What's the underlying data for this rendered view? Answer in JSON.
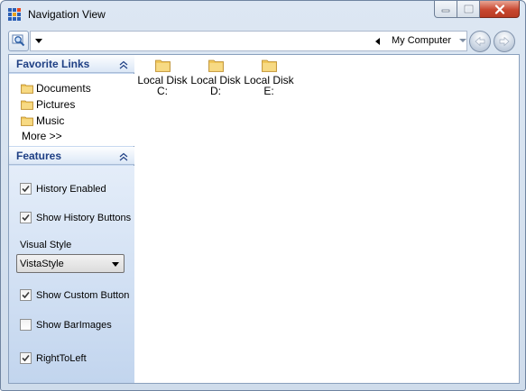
{
  "window": {
    "title": "Navigation View"
  },
  "address_bar": {
    "location": "My Computer"
  },
  "favorite_links": {
    "header": "Favorite Links",
    "items": [
      "Documents",
      "Pictures",
      "Music"
    ],
    "more": "More >>"
  },
  "features": {
    "header": "Features",
    "history_enabled": {
      "label": "History Enabled",
      "checked": true
    },
    "show_history_buttons": {
      "label": "Show History Buttons",
      "checked": true
    },
    "visual_style_label": "Visual Style",
    "visual_style_value": "VistaStyle",
    "show_custom_button": {
      "label": "Show Custom Button",
      "checked": true
    },
    "show_bar_images": {
      "label": "Show BarImages",
      "checked": false
    },
    "right_to_left": {
      "label": "RightToLeft",
      "checked": true
    }
  },
  "drives": [
    {
      "line1": "Local Disk",
      "line2": "C:"
    },
    {
      "line1": "Local Disk",
      "line2": "D:"
    },
    {
      "line1": "Local Disk",
      "line2": "E:"
    }
  ],
  "colors": {
    "header_text": "#1e3f84",
    "folder": "#f0c75a",
    "sidebar_bg": "#c7d9f0",
    "close_button": "#c8472f"
  }
}
